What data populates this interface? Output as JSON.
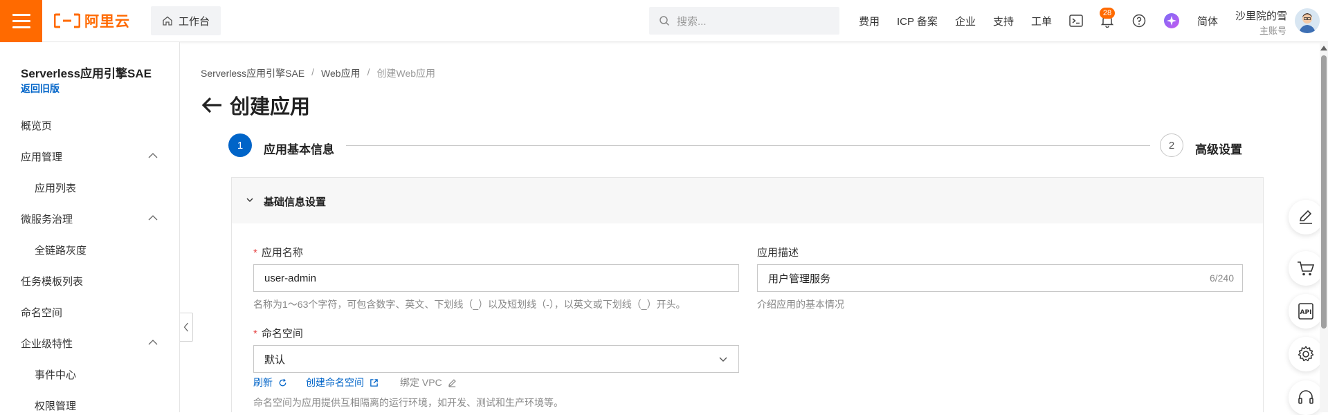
{
  "header": {
    "brand": "阿里云",
    "workbench_label": "工作台",
    "search_placeholder": "搜索...",
    "nav": [
      "费用",
      "ICP 备案",
      "企业",
      "支持",
      "工单"
    ],
    "notifications_count": "28",
    "language": "简体",
    "user_name": "沙里院的雪",
    "user_role": "主账号",
    "accent_color": "#ff6a00"
  },
  "sidebar": {
    "title": "Serverless应用引擎SAE",
    "back_link": "返回旧版",
    "items": [
      {
        "label": "概览页"
      },
      {
        "label": "应用管理",
        "expanded": true
      },
      {
        "label": "应用列表",
        "sub": true
      },
      {
        "label": "微服务治理",
        "expanded": true
      },
      {
        "label": "全链路灰度",
        "sub": true
      },
      {
        "label": "任务模板列表"
      },
      {
        "label": "命名空间"
      },
      {
        "label": "企业级特性",
        "expanded": true
      },
      {
        "label": "事件中心",
        "sub": true
      },
      {
        "label": "权限管理",
        "sub": true
      }
    ]
  },
  "breadcrumb": {
    "items": [
      "Serverless应用引擎SAE",
      "Web应用",
      "创建Web应用"
    ],
    "separator": "/"
  },
  "page": {
    "title": "创建应用"
  },
  "steps": [
    {
      "number": "1",
      "label": "应用基本信息",
      "active": true
    },
    {
      "number": "2",
      "label": "高级设置",
      "active": false
    }
  ],
  "form": {
    "section_title": "基础信息设置",
    "app_name": {
      "label": "应用名称",
      "value": "user-admin",
      "hint": "名称为1～63个字符，可包含数字、英文、下划线（_）以及短划线（-），以英文或下划线（_）开头。"
    },
    "app_desc": {
      "label": "应用描述",
      "value": "用户管理服务",
      "counter": "6/240",
      "hint": "介绍应用的基本情况"
    },
    "namespace": {
      "label": "命名空间",
      "value": "默认",
      "refresh_label": "刷新",
      "create_label": "创建命名空间",
      "bind_vpc_label": "绑定 VPC",
      "hint": "命名空间为应用提供互相隔离的运行环境，如开发、测试和生产环境等。"
    }
  },
  "colors": {
    "primary": "#0064c8",
    "required": "#e54545"
  }
}
